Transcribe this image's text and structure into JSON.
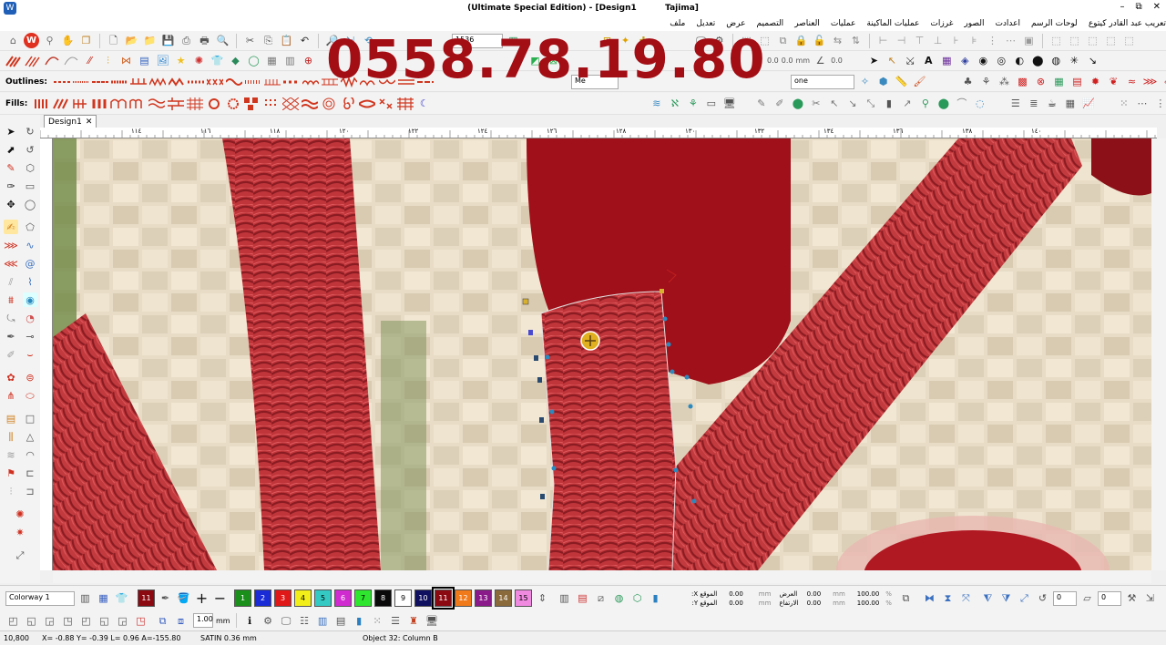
{
  "window": {
    "title": "(Ultimate Special Edition) - [Design1          Tajima]",
    "title_part1": "(Ultimate Special Edition) - [Design1",
    "title_part2": "Tajima]",
    "controls": [
      "–",
      "⧉",
      "✕"
    ]
  },
  "menu": [
    "ملف",
    "تعديل",
    "عرض",
    "التصميم",
    "العناصر",
    "عمليات",
    "عمليات الماكينة",
    "غرزات",
    "الصور",
    "اعدادت",
    "لوحات الرسم",
    "تعريب عبد القادر كيتوع"
  ],
  "toolbar": {
    "zoom_value": "1536",
    "combo_me": "Me",
    "combo_none": "one",
    "outlines_label": "Outlines:",
    "fills_label": "Fills:",
    "field_values": [
      "0.0",
      "0.0",
      "mm"
    ]
  },
  "overlay": {
    "phone_number": "0558.78.19.80"
  },
  "document": {
    "tab_label": "Design1",
    "close": "✕"
  },
  "ruler_labels": [
    "١١٤",
    "١١٦",
    "١١٨",
    "١٢٠",
    "١٢٢",
    "١٢٤",
    "١٢٦",
    "١٢٨",
    "١٣٠",
    "١٣٢",
    "١٣٤",
    "١٣٦",
    "١٣٨",
    "١٤٠"
  ],
  "palette": {
    "colorway": "Colorway 1",
    "current_color_number": "11",
    "current_color": "#8b0a12",
    "swatches": [
      {
        "n": "1",
        "color": "#1a8f1a"
      },
      {
        "n": "2",
        "color": "#1a2cd6"
      },
      {
        "n": "3",
        "color": "#e01818"
      },
      {
        "n": "4",
        "color": "#f2ee1a"
      },
      {
        "n": "5",
        "color": "#35c9c4"
      },
      {
        "n": "6",
        "color": "#d02bd0"
      },
      {
        "n": "7",
        "color": "#2ee62e"
      },
      {
        "n": "8",
        "color": "#0a0a0a"
      },
      {
        "n": "9",
        "color": "#ffffff"
      },
      {
        "n": "10",
        "color": "#101060"
      },
      {
        "n": "11",
        "color": "#8b0a12"
      },
      {
        "n": "12",
        "color": "#f07a1a"
      },
      {
        "n": "13",
        "color": "#8a1a8a"
      },
      {
        "n": "14",
        "color": "#8a6a3a"
      },
      {
        "n": "15",
        "color": "#f08ae0"
      }
    ]
  },
  "position": {
    "x_label": "الموقع X:",
    "y_label": "الموقع Y:",
    "x_value": "0.00",
    "y_value": "0.00",
    "unit": "mm",
    "width_label": "العرض",
    "height_label": "الارتفاع",
    "width_value": "0.00",
    "height_value": "0.00",
    "w_pct": "100.00",
    "h_pct": "100.00",
    "pct": "%",
    "rotate_value": "0",
    "other_value": "0"
  },
  "bottombar2": {
    "size_value": "1.00",
    "size_unit": "mm"
  },
  "status": {
    "stitch_count": "10,800",
    "coords": "X=  -0.88 Y=  -0.39 L=  0.96 A=-155.80",
    "stitch_info": "SATIN  0.36 mm",
    "object_info": "Object 32: Column B"
  }
}
